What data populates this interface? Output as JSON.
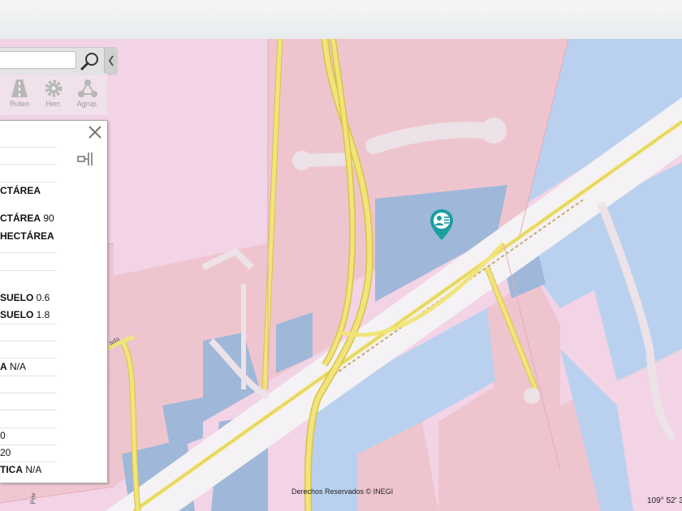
{
  "search": {
    "placeholder": ""
  },
  "toolbar": {
    "items": [
      {
        "label": "Ruteo",
        "icon": "road-icon"
      },
      {
        "label": "Herr.",
        "icon": "gear-icon"
      },
      {
        "label": "Agrup.",
        "icon": "network-icon"
      }
    ]
  },
  "panel": {
    "rows": [
      {
        "bold": "CTÁREA",
        "value": ""
      },
      {
        "bold": "CTÁREA",
        "value": " 90"
      },
      {
        "bold": "HECTÁREA",
        "value": ""
      },
      {
        "bold": "SUELO",
        "value": " 0.6"
      },
      {
        "bold": "SUELO",
        "value": " 1.8"
      },
      {
        "bold": "A",
        "value": " N/A"
      },
      {
        "bold": "",
        "value": "0"
      },
      {
        "bold": "",
        "value": "20"
      },
      {
        "bold": "TICA",
        "value": " N/A"
      }
    ]
  },
  "map": {
    "credit": "Derechos Reservados © INEGI",
    "coordinate": "109° 52' 3",
    "road_labels": [
      "Priv",
      "ada"
    ],
    "colors": {
      "residential": "#f3d3e6",
      "urban_block": "#eec5ce",
      "water_zone": "#b9d1ef",
      "blue_block": "#9fb8da",
      "road_yellow": "#f1e47a",
      "road_border": "#d8c24a",
      "marker": "#1c9ea0"
    }
  }
}
